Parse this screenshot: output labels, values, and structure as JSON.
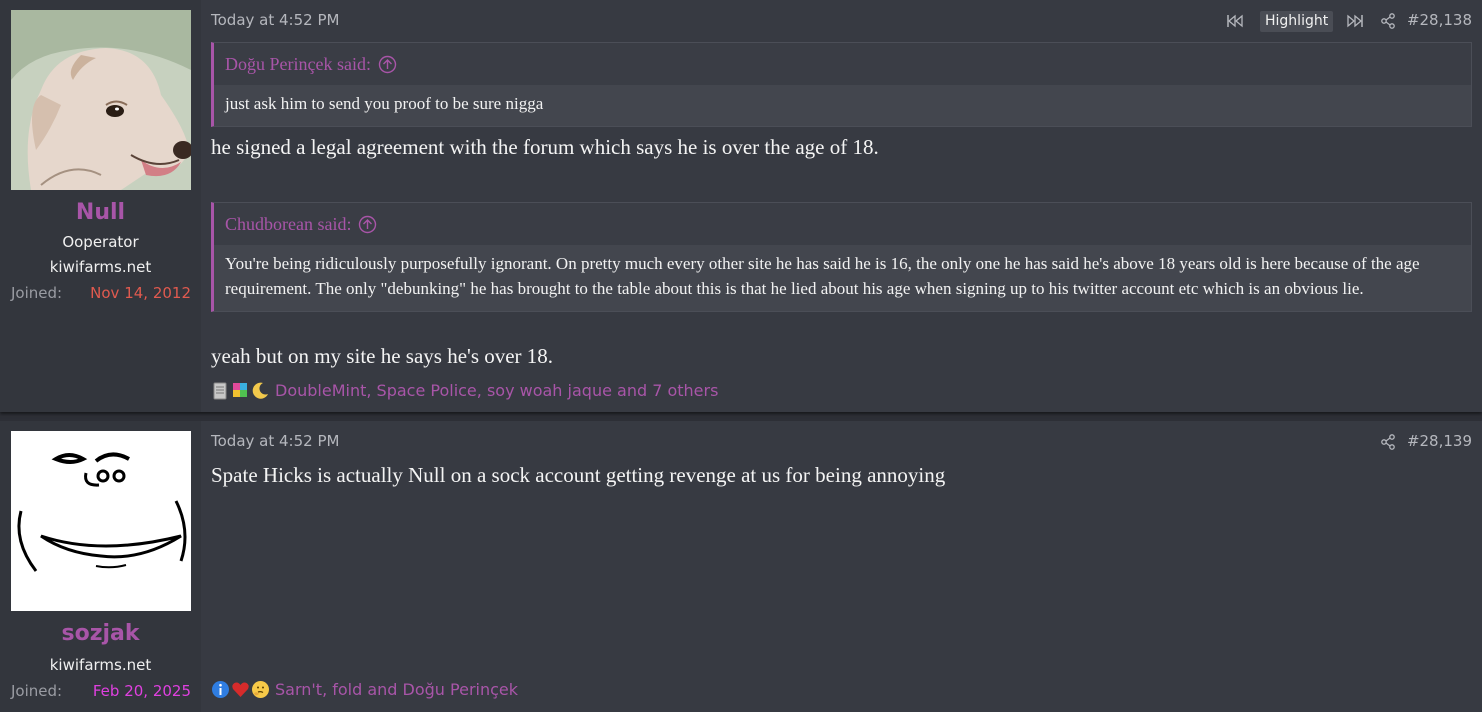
{
  "posts": [
    {
      "user": {
        "name": "Null",
        "title": "Ooperator",
        "site": "kiwifarms.net",
        "joined_label": "Joined:",
        "joined_date": "Nov 14, 2012",
        "joined_color": "#e05a4f",
        "avatar": "dog-portrait"
      },
      "date": "Today at 4:52 PM",
      "highlight_label": "Highlight",
      "post_number": "#28,138",
      "quotes": [
        {
          "author": "Doğu Perinçek said:",
          "text": "just ask him to send you proof to be sure nigga"
        },
        {
          "author": "Chudborean said:",
          "text": "You're being ridiculously purposefully ignorant. On pretty much every other site he has said he is 16, the only one he has said he's above 18 years old is here because of the age requirement. The only \"debunking\" he has brought to the table about this is that he lied about his age when signing up to his twitter account etc which is an obvious lie."
        }
      ],
      "messages": [
        "he signed a legal agreement with the forum which says he is over the age of 18.",
        "yeah but on my site he says he's over 18."
      ],
      "reactions": {
        "icons": [
          "document-icon",
          "puzzle-icon",
          "moon-icon"
        ],
        "names": "DoubleMint, Space Police, soy woah jaque and 7 others"
      }
    },
    {
      "user": {
        "name": "sozjak",
        "site": "kiwifarms.net",
        "joined_label": "Joined:",
        "joined_date": "Feb 20, 2025",
        "joined_color": "#e040e0",
        "avatar": "sketch-face"
      },
      "date": "Today at 4:52 PM",
      "post_number": "#28,139",
      "messages": [
        "Spate Hicks is actually Null on a sock account getting revenge at us for being annoying"
      ],
      "reactions": {
        "icons": [
          "info-icon",
          "heart-icon",
          "thinking-icon"
        ],
        "names": "Sarn't, fold and Doğu Perinçek"
      }
    }
  ],
  "colors": {
    "accent": "#a855a8",
    "background": "#373a42",
    "sidebar": "#33363d"
  }
}
